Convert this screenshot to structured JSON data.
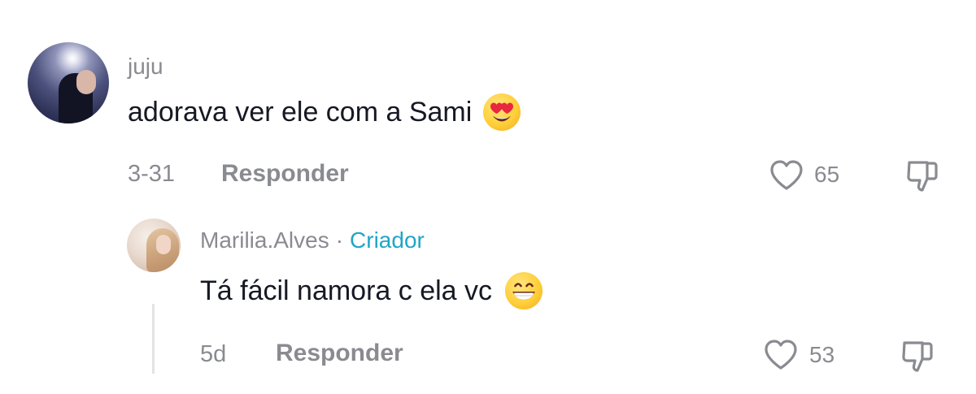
{
  "comment": {
    "username": "juju",
    "text": "adorava ver ele com a Sami",
    "emoji": "heart-eyes-emoji",
    "date": "3-31",
    "reply_label": "Responder",
    "likes": "65"
  },
  "reply": {
    "username": "Marilia.Alves",
    "separator": "·",
    "badge": "Criador",
    "text": "Tá fácil namora c ela vc",
    "emoji": "grinning-emoji",
    "date": "5d",
    "reply_label": "Responder",
    "likes": "53"
  },
  "colors": {
    "secondary_text": "#8a8b91",
    "primary_text": "#161823",
    "creator_badge": "#20a5c8"
  }
}
